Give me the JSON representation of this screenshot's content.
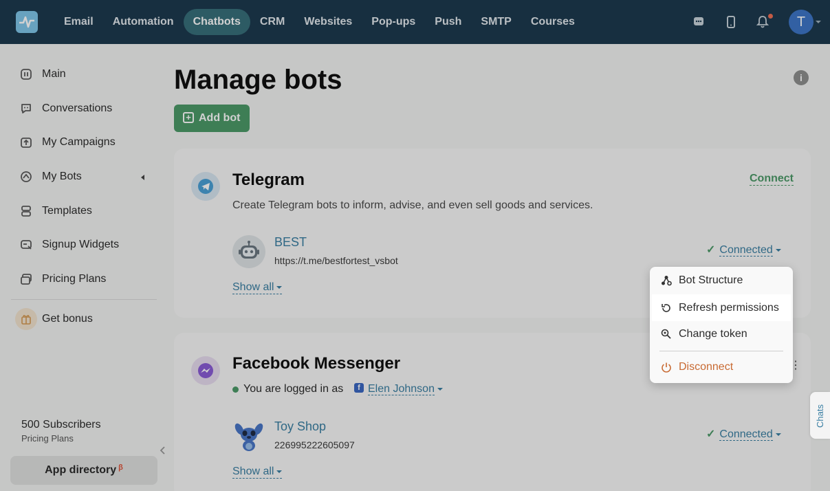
{
  "nav": {
    "items": [
      "Email",
      "Automation",
      "Chatbots",
      "CRM",
      "Websites",
      "Pop-ups",
      "Push",
      "SMTP",
      "Courses"
    ],
    "active": "Chatbots",
    "avatar_letter": "T"
  },
  "sidebar": {
    "items": [
      {
        "label": "Main",
        "icon": "dashboard-icon"
      },
      {
        "label": "Conversations",
        "icon": "chat-bubble-icon"
      },
      {
        "label": "My Campaigns",
        "icon": "campaign-upload-icon"
      },
      {
        "label": "My Bots",
        "icon": "bot-icon"
      },
      {
        "label": "Templates",
        "icon": "templates-icon"
      },
      {
        "label": "Signup Widgets",
        "icon": "widget-icon"
      },
      {
        "label": "Pricing Plans",
        "icon": "pricing-icon"
      }
    ],
    "bonus_label": "Get bonus",
    "subscribers": "500 Subscribers",
    "plan_link": "Pricing Plans",
    "app_directory": "App directory",
    "beta_mark": "β"
  },
  "main": {
    "title": "Manage bots",
    "add_bot": "Add bot",
    "info": "i"
  },
  "telegram": {
    "title": "Telegram",
    "description": "Create Telegram bots to inform, advise, and even sell goods and services.",
    "connect": "Connect",
    "bot_name": "BEST",
    "bot_url": "https://t.me/bestfortest_vsbot",
    "status": "Connected",
    "show_all": "Show all"
  },
  "facebook": {
    "title": "Facebook Messenger",
    "logged_in": "You are logged in as",
    "user": "Elen Johnson",
    "bot_name": "Toy Shop",
    "bot_id": "226995222605097",
    "status": "Connected",
    "show_all": "Show all"
  },
  "dropdown": {
    "items": [
      "Bot Structure",
      "Refresh permissions",
      "Change token"
    ],
    "disconnect": "Disconnect"
  },
  "chats_tab": "Chats",
  "colors": {
    "nav_bg": "#1d3a4f",
    "active_nav": "#386f7b",
    "accent_green": "#4c9a68",
    "link_blue": "#3a7fa3",
    "danger": "#c86a32"
  }
}
